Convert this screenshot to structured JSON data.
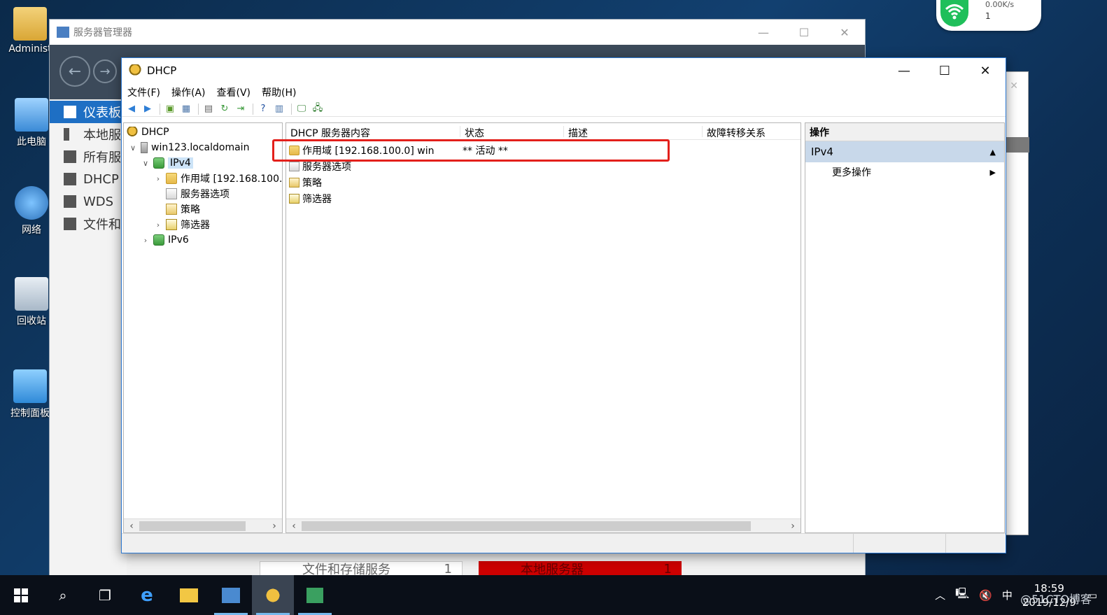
{
  "desktop": {
    "icons": [
      {
        "label": "Administ"
      },
      {
        "label": "此电脑"
      },
      {
        "label": "网络"
      },
      {
        "label": "回收站"
      },
      {
        "label": "控制面板"
      }
    ]
  },
  "network_widget": {
    "speed": "0.00K/s",
    "count": "1"
  },
  "server_manager": {
    "title": "服务器管理器",
    "sidebar": [
      {
        "label": "仪表板"
      },
      {
        "label": "本地服务器"
      },
      {
        "label": "所有服务器"
      },
      {
        "label": "DHCP"
      },
      {
        "label": "WDS"
      },
      {
        "label": "文件和存储服务"
      }
    ],
    "tiles": [
      {
        "label": "文件和存储服务",
        "count": "1"
      },
      {
        "label": "本地服务器",
        "count": "1"
      }
    ]
  },
  "dhcp": {
    "title": "DHCP",
    "menu": [
      "文件(F)",
      "操作(A)",
      "查看(V)",
      "帮助(H)"
    ],
    "tree": [
      {
        "label": "DHCP"
      },
      {
        "label": "win123.localdomain"
      },
      {
        "label": "IPv4"
      },
      {
        "label": "作用域 [192.168.100."
      },
      {
        "label": "服务器选项"
      },
      {
        "label": "策略"
      },
      {
        "label": "筛选器"
      },
      {
        "label": "IPv6"
      }
    ],
    "columns": [
      "DHCP 服务器内容",
      "状态",
      "描述",
      "故障转移关系"
    ],
    "rows": [
      {
        "name": "作用域 [192.168.100.0] win",
        "status": "** 活动 **"
      },
      {
        "name": "服务器选项",
        "status": ""
      },
      {
        "name": "策略",
        "status": ""
      },
      {
        "name": "筛选器",
        "status": ""
      }
    ],
    "actions": {
      "header": "操作",
      "section": "IPv4",
      "items": [
        "更多操作"
      ]
    }
  },
  "taskbar": {
    "ime": "中",
    "time": "18:59",
    "date": "2019/12/9",
    "watermark": "@51CTO博客"
  }
}
